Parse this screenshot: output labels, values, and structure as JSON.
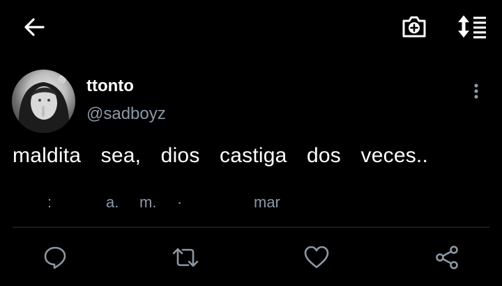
{
  "header": {
    "back_icon": "arrow-left-icon",
    "camera_icon": "camera-plus-icon",
    "sort_icon": "sort-list-icon"
  },
  "tweet": {
    "name": "ttonto",
    "handle": "@sadboyz",
    "text": "maldita sea, dios castiga dos veces..",
    "meta": {
      "colon": ":",
      "a": "a.",
      "m": "m.",
      "dot": "·",
      "month": "mar"
    }
  },
  "actions": {
    "reply_icon": "reply-icon",
    "retweet_icon": "retweet-icon",
    "like_icon": "heart-icon",
    "share_icon": "share-icon"
  },
  "colors": {
    "background": "#000000",
    "text": "#ffffff",
    "secondary": "#8b98a5",
    "divider": "#2f3336"
  }
}
